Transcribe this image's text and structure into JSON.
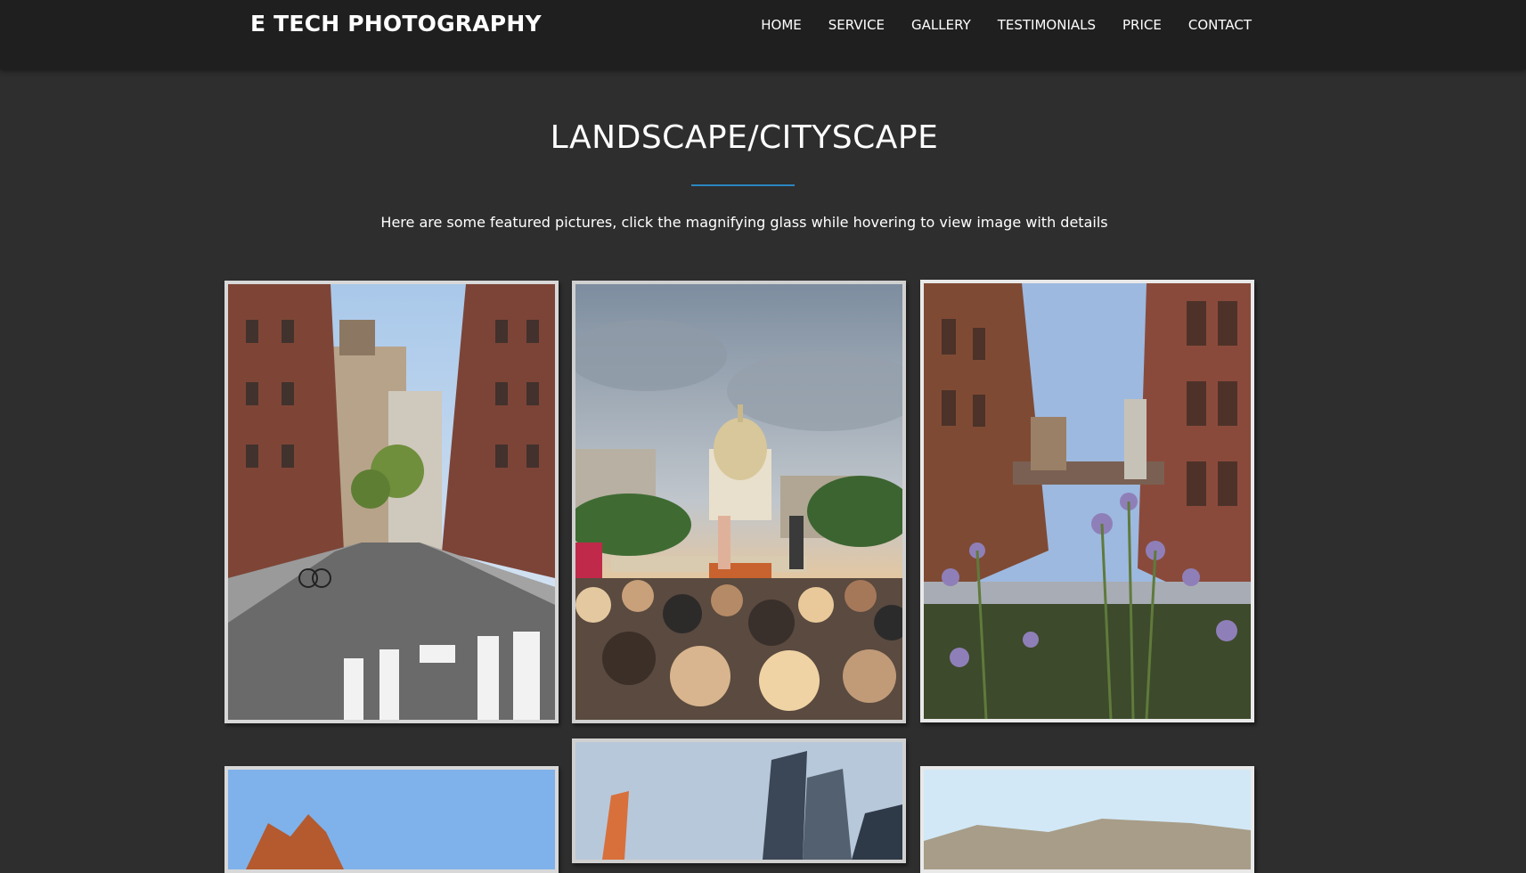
{
  "header": {
    "brand": "E TECH PHOTOGRAPHY",
    "nav": [
      "HOME",
      "SERVICE",
      "GALLERY",
      "TESTIMONIALS",
      "PRICE",
      "CONTACT"
    ]
  },
  "section": {
    "title": "LANDSCAPE/CITYSCAPE",
    "subtitle": "Here are some featured pictures, click the magnifying glass while hovering to view image with details"
  },
  "colors": {
    "background": "#2e2e2e",
    "navbar": "#1f1f1f",
    "accent": "#2b86c1"
  }
}
